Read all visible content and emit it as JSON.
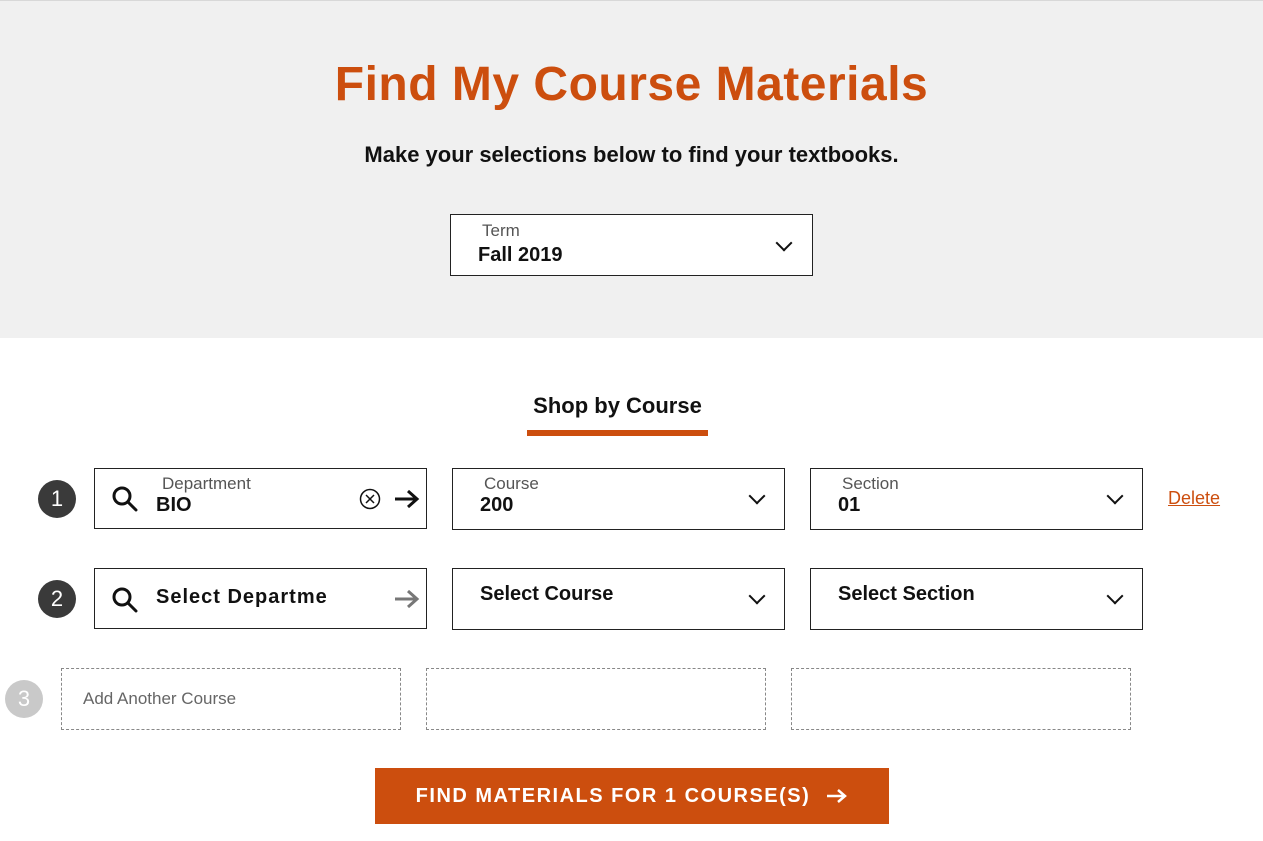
{
  "hero": {
    "title": "Find My Course Materials",
    "subtitle": "Make your selections below to find your textbooks."
  },
  "term": {
    "label": "Term",
    "value": "Fall 2019"
  },
  "tabs": [
    {
      "label": "Shop by Course",
      "active": true
    }
  ],
  "rows": [
    {
      "number": "1",
      "department": {
        "label": "Department",
        "value": "BIO"
      },
      "course": {
        "label": "Course",
        "value": "200"
      },
      "section": {
        "label": "Section",
        "value": "01"
      },
      "delete_label": "Delete"
    },
    {
      "number": "2",
      "department": {
        "placeholder": "Select Departme"
      },
      "course": {
        "placeholder": "Select Course"
      },
      "section": {
        "placeholder": "Select Section"
      }
    },
    {
      "number": "3",
      "add_label": "Add Another Course"
    }
  ],
  "cta": {
    "label": "FIND MATERIALS FOR 1 COURSE(S)"
  },
  "colors": {
    "accent": "#cc4e0e",
    "hero_bg": "#f0f0f0",
    "badge": "#3a3a3a",
    "badge_inactive": "#c9c9c9"
  },
  "icons": [
    "search-icon",
    "clear-icon",
    "arrow-right-icon",
    "chevron-down-icon"
  ]
}
